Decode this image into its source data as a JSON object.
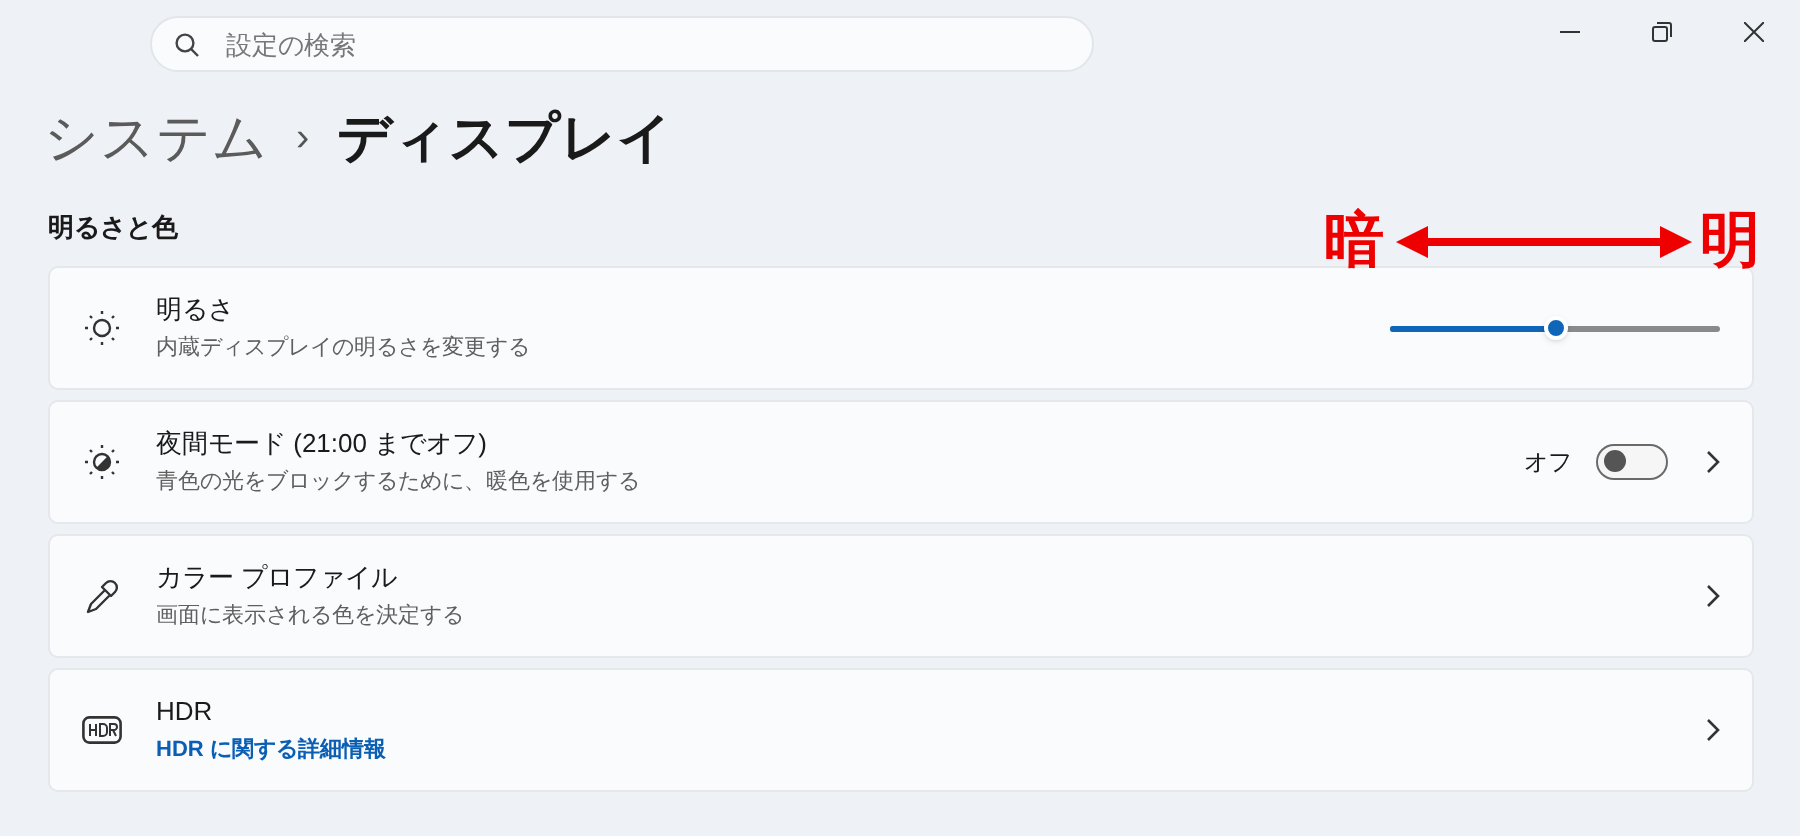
{
  "search": {
    "placeholder": "設定の検索"
  },
  "breadcrumb": {
    "parent": "システム",
    "separator": "›",
    "current": "ディスプレイ"
  },
  "section_title": "明るさと色",
  "annotation": {
    "left": "暗",
    "right": "明"
  },
  "rows": [
    {
      "kind": "slider",
      "title": "明るさ",
      "subtitle": "内蔵ディスプレイの明るさを変更する",
      "level": 0.5
    },
    {
      "kind": "toggle",
      "title": "夜間モード (21:00 までオフ)",
      "subtitle": "青色の光をブロックするために、暖色を使用する",
      "state_label": "オフ",
      "on": false
    },
    {
      "kind": "nav",
      "title": "カラー プロファイル",
      "subtitle": "画面に表示される色を決定する"
    },
    {
      "kind": "link",
      "title": "HDR",
      "subtitle": "HDR に関する詳細情報"
    }
  ]
}
